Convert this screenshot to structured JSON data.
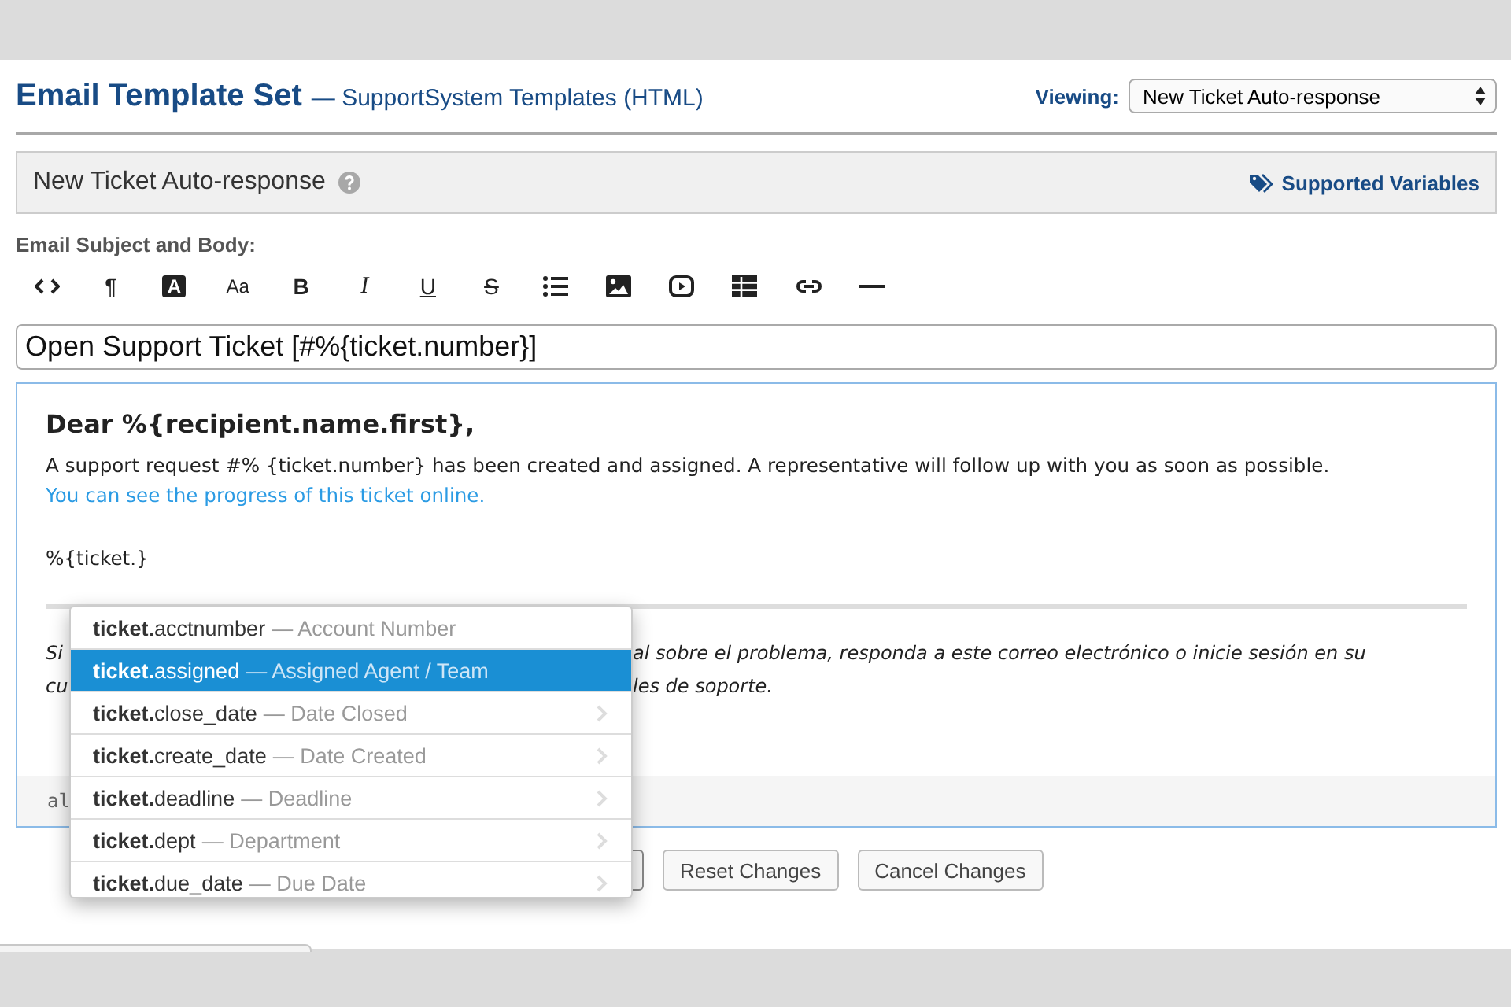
{
  "header": {
    "title": "Email Template Set",
    "subtitle": "— SupportSystem Templates (HTML)",
    "viewing_label": "Viewing:",
    "viewing_value": "New Ticket Auto-response"
  },
  "panel": {
    "title": "New Ticket Auto-response",
    "link": "Supported Variables"
  },
  "editor_label": "Email Subject and Body:",
  "toolbar": [
    {
      "kind": "code"
    },
    {
      "kind": "glyph",
      "glyph": "¶"
    },
    {
      "kind": "boxed",
      "glyph": "A"
    },
    {
      "kind": "size",
      "glyph": "Aa"
    },
    {
      "kind": "bold",
      "glyph": "B"
    },
    {
      "kind": "italic",
      "glyph": "I"
    },
    {
      "kind": "underline",
      "glyph": "U"
    },
    {
      "kind": "strike",
      "glyph": "S"
    },
    {
      "kind": "list"
    },
    {
      "kind": "image"
    },
    {
      "kind": "video"
    },
    {
      "kind": "table"
    },
    {
      "kind": "link"
    },
    {
      "kind": "rule"
    }
  ],
  "subject": "Open Support Ticket [#%{ticket.number}]",
  "body": {
    "greeting": "Dear %{recipient.name.first},",
    "paragraph": "A support request #% {ticket.number} has been created and assigned. A representative will follow up with you as soon as possible.",
    "link": "You can see the progress of this ticket online.",
    "typed": "%{ticket.}",
    "hidden_lines": [
      {
        "left": "Si",
        "right": "al sobre el problema, responda a este correo electrónico o inicie sesión en su"
      },
      {
        "left": "cu",
        "right": "les de soporte."
      }
    ],
    "status_text": "al"
  },
  "suggestions": [
    {
      "name": "**ticket.**acctnumber",
      "desc": "— Account Number",
      "selected": false,
      "chevron": false
    },
    {
      "name": "**ticket.**assigned",
      "desc": "— Assigned Agent / Team",
      "selected": true,
      "chevron": false
    },
    {
      "name": "**ticket.**close_date",
      "desc": "— Date Closed",
      "selected": false,
      "chevron": true
    },
    {
      "name": "**ticket.**create_date",
      "desc": "— Date Created",
      "selected": false,
      "chevron": true
    },
    {
      "name": "**ticket.**deadline",
      "desc": "— Deadline",
      "selected": false,
      "chevron": true
    },
    {
      "name": "**ticket.**dept",
      "desc": "— Department",
      "selected": false,
      "chevron": true
    },
    {
      "name": "**ticket.**due_date",
      "desc": "— Due Date",
      "selected": false,
      "chevron": true
    }
  ],
  "buttons": [
    {
      "kind": "covered"
    },
    {
      "kind": "text",
      "label": "Reset Changes"
    },
    {
      "kind": "text",
      "label": "Cancel Changes"
    }
  ]
}
